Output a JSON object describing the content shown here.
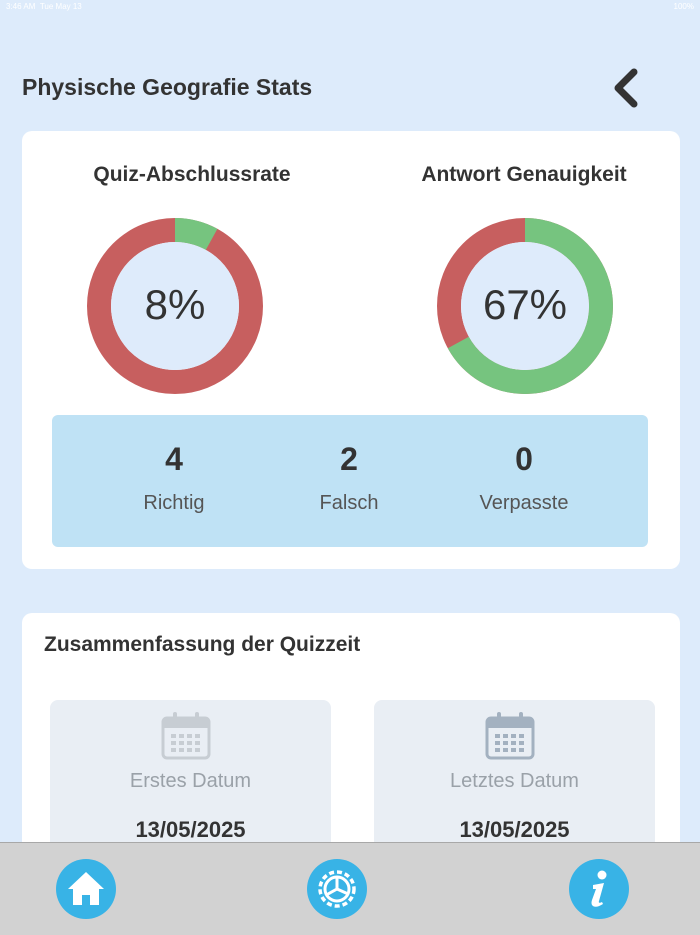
{
  "status_bar": {
    "time": "3:46 AM",
    "date": "Tue May 13",
    "battery": "100%"
  },
  "header": {
    "title": "Physische Geografie Stats"
  },
  "stats": {
    "completion": {
      "title": "Quiz-Abschlussrate",
      "value_text": "8%",
      "value": 0.08
    },
    "accuracy": {
      "title": "Antwort Genauigkeit",
      "value_text": "67%",
      "value": 0.67
    },
    "counts": [
      {
        "value": "4",
        "label": "Richtig"
      },
      {
        "value": "2",
        "label": "Falsch"
      },
      {
        "value": "0",
        "label": "Verpasste"
      }
    ]
  },
  "time_summary": {
    "title": "Zusammenfassung der Quizzeit",
    "first": {
      "label": "Erstes Datum",
      "value": "13/05/2025"
    },
    "last": {
      "label": "Letztes Datum",
      "value": "13/05/2025"
    }
  },
  "colors": {
    "correct": "#76c47f",
    "incorrect": "#c75f5f",
    "gauge_inner": "#deebfb",
    "accent": "#38b3e6"
  },
  "tab_bar": {
    "icons": [
      "home-icon",
      "settings-icon",
      "info-icon"
    ]
  }
}
